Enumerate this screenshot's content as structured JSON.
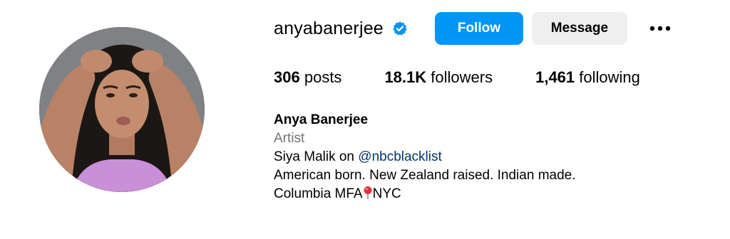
{
  "profile": {
    "username": "anyabanerjee",
    "verified": true,
    "follow_label": "Follow",
    "message_label": "Message",
    "more_label": "•••"
  },
  "stats": {
    "posts_count": "306",
    "posts_label": "posts",
    "followers_count": "18.1K",
    "followers_label": "followers",
    "following_count": "1,461",
    "following_label": "following"
  },
  "bio": {
    "name": "Anya Banerjee",
    "category": "Artist",
    "line1_prefix": "Siya Malik on ",
    "line1_link": "@nbcblacklist",
    "line2": "American born. New Zealand raised. Indian made.",
    "line3_prefix": "Columbia MFA",
    "line3_suffix": "NYC"
  },
  "colors": {
    "accent": "#0095f6",
    "secondary_button": "#efefef",
    "muted_text": "#737373",
    "link": "#00376b"
  },
  "icons": {
    "verified": "verified-badge-icon",
    "more": "more-options-icon",
    "pin": "round-pushpin-icon"
  }
}
